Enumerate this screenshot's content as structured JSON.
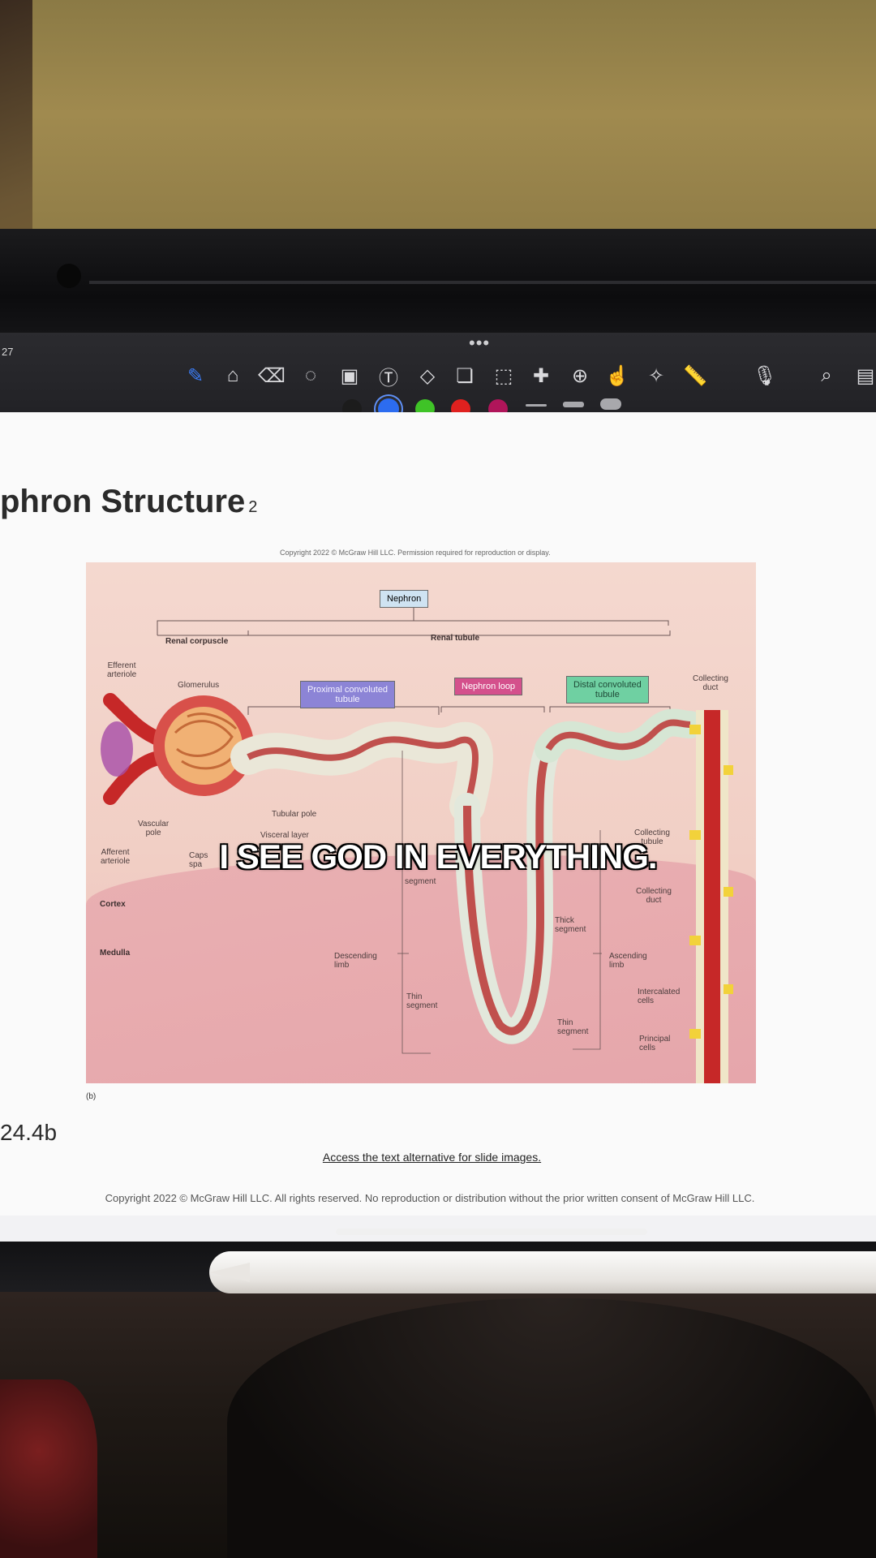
{
  "toolbar": {
    "time": "27",
    "more": "•••",
    "tools": [
      {
        "icon": "pen-icon",
        "glyph": "✎"
      },
      {
        "icon": "highlighter-icon",
        "glyph": "⌂"
      },
      {
        "icon": "eraser-icon",
        "glyph": "⌫"
      },
      {
        "icon": "lasso-icon",
        "glyph": "◌"
      },
      {
        "icon": "image-icon",
        "glyph": "▣"
      },
      {
        "icon": "text-icon",
        "glyph": "Ⓣ"
      },
      {
        "icon": "shape-icon",
        "glyph": "◇"
      },
      {
        "icon": "sticker-icon",
        "glyph": "❏"
      },
      {
        "icon": "selection-icon",
        "glyph": "⬚"
      },
      {
        "icon": "tape-icon",
        "glyph": "✚"
      },
      {
        "icon": "zoom-window-icon",
        "glyph": "⊕"
      },
      {
        "icon": "hand-icon",
        "glyph": "☝"
      },
      {
        "icon": "laser-pointer-icon",
        "glyph": "✧"
      },
      {
        "icon": "ruler-icon",
        "glyph": "📏"
      },
      {
        "icon": "microphone-icon",
        "glyph": "🎙"
      },
      {
        "icon": "search-icon",
        "glyph": "⌕"
      },
      {
        "icon": "page-icon",
        "glyph": "▤"
      }
    ],
    "colors": [
      "#1c1c1c",
      "#2c6cf0",
      "#3fc327",
      "#e0211f",
      "#b0155a"
    ]
  },
  "slide": {
    "title": "phron Structure",
    "title_sub": "2",
    "figure_copyright": "Copyright 2022 © McGraw Hill LLC. Permission required for reproduction or display.",
    "figure_tag": "(b)",
    "figure_number": "24.4b",
    "alt_link": "Access the text alternative for slide images.",
    "copyright": "Copyright 2022 © McGraw Hill LLC. All rights reserved. No reproduction or distribution without the prior written consent of McGraw Hill LLC."
  },
  "figure": {
    "nephron": "Nephron",
    "renal_corpuscle": "Renal corpuscle",
    "renal_tubule": "Renal tubule",
    "efferent_arteriole": "Efferent\narteriole",
    "glomerulus": "Glomerulus",
    "pct": "Proximal convoluted\ntubule",
    "nephron_loop": "Nephron loop",
    "dct": "Distal convoluted\ntubule",
    "collecting_duct_top": "Collecting\nduct",
    "tubular_pole": "Tubular pole",
    "vascular_pole": "Vascular\npole",
    "visceral_layer": "Visceral layer",
    "afferent_arteriole": "Afferent\narteriole",
    "capsular_space": "Caps\nspa",
    "segment": "segment",
    "collecting_tubule": "Collecting\ntubule",
    "collecting_duct_mid": "Collecting\nduct",
    "cortex": "Cortex",
    "medulla": "Medulla",
    "thick_segment": "Thick\nsegment",
    "descending_limb": "Descending\nlimb",
    "ascending_limb": "Ascending\nlimb",
    "thin_segment_left": "Thin\nsegment",
    "thin_segment_right": "Thin\nsegment",
    "intercalated_cells": "Intercalated\ncells",
    "principal_cells": "Principal\ncells"
  },
  "caption": "I SEE GOD IN EVERYTHING."
}
